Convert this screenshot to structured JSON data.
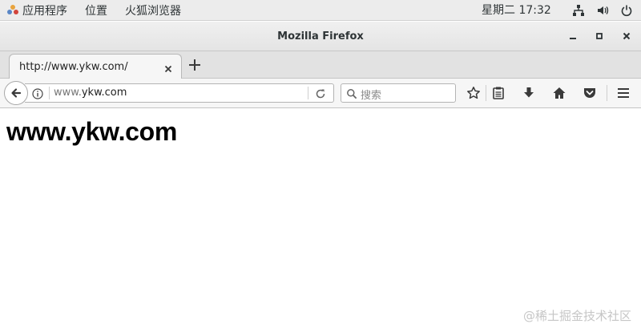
{
  "topbar": {
    "menu": [
      "应用程序",
      "位置",
      "火狐浏览器"
    ],
    "clock": "星期二 17:32"
  },
  "window": {
    "title": "Mozilla Firefox"
  },
  "tab": {
    "title": "http://www.ykw.com/"
  },
  "navbar": {
    "url_prefix": "www.",
    "url_domain": "ykw.com",
    "search_placeholder": "搜索"
  },
  "page": {
    "heading": "www.ykw.com"
  },
  "watermark": "@稀土掘金技术社区",
  "colors": {
    "topbar_bg": "#ececec",
    "toolbar_bg": "#f6f6f6",
    "icon": "#3a3a3a"
  },
  "icons": [
    "activities-icon",
    "network-icon",
    "volume-icon",
    "power-icon",
    "minimize-icon",
    "maximize-icon",
    "close-icon",
    "back-arrow-icon",
    "info-icon",
    "reload-icon",
    "search-icon",
    "bookmark-star-icon",
    "reading-list-icon",
    "download-icon",
    "home-icon",
    "pocket-icon",
    "menu-icon"
  ]
}
